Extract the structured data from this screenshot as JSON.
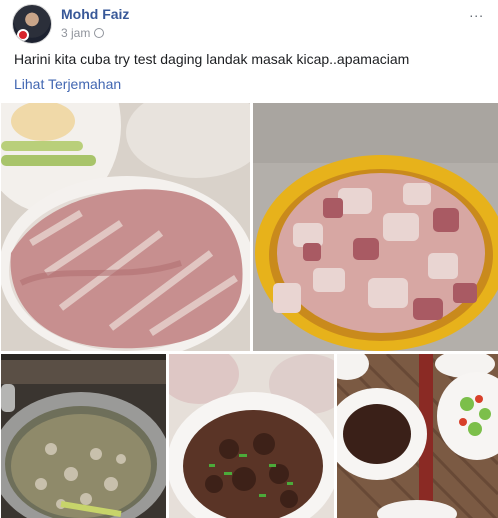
{
  "post": {
    "author": "Mohd Faiz",
    "time": "3 jam",
    "more_icon": "...",
    "text": "Harini kita cuba try test daging landak masak kicap..apamaciam",
    "translate_link": "Lihat Terjemahan"
  },
  "photos": [
    {
      "name": "raw-meat-plate-photo"
    },
    {
      "name": "chopped-meat-basin-photo"
    },
    {
      "name": "boiling-pot-photo"
    },
    {
      "name": "cooked-meat-plate-photo"
    },
    {
      "name": "served-meal-table-photo"
    }
  ],
  "colors": {
    "author": "#385898",
    "link": "#4267b2",
    "meta": "#90949c"
  }
}
